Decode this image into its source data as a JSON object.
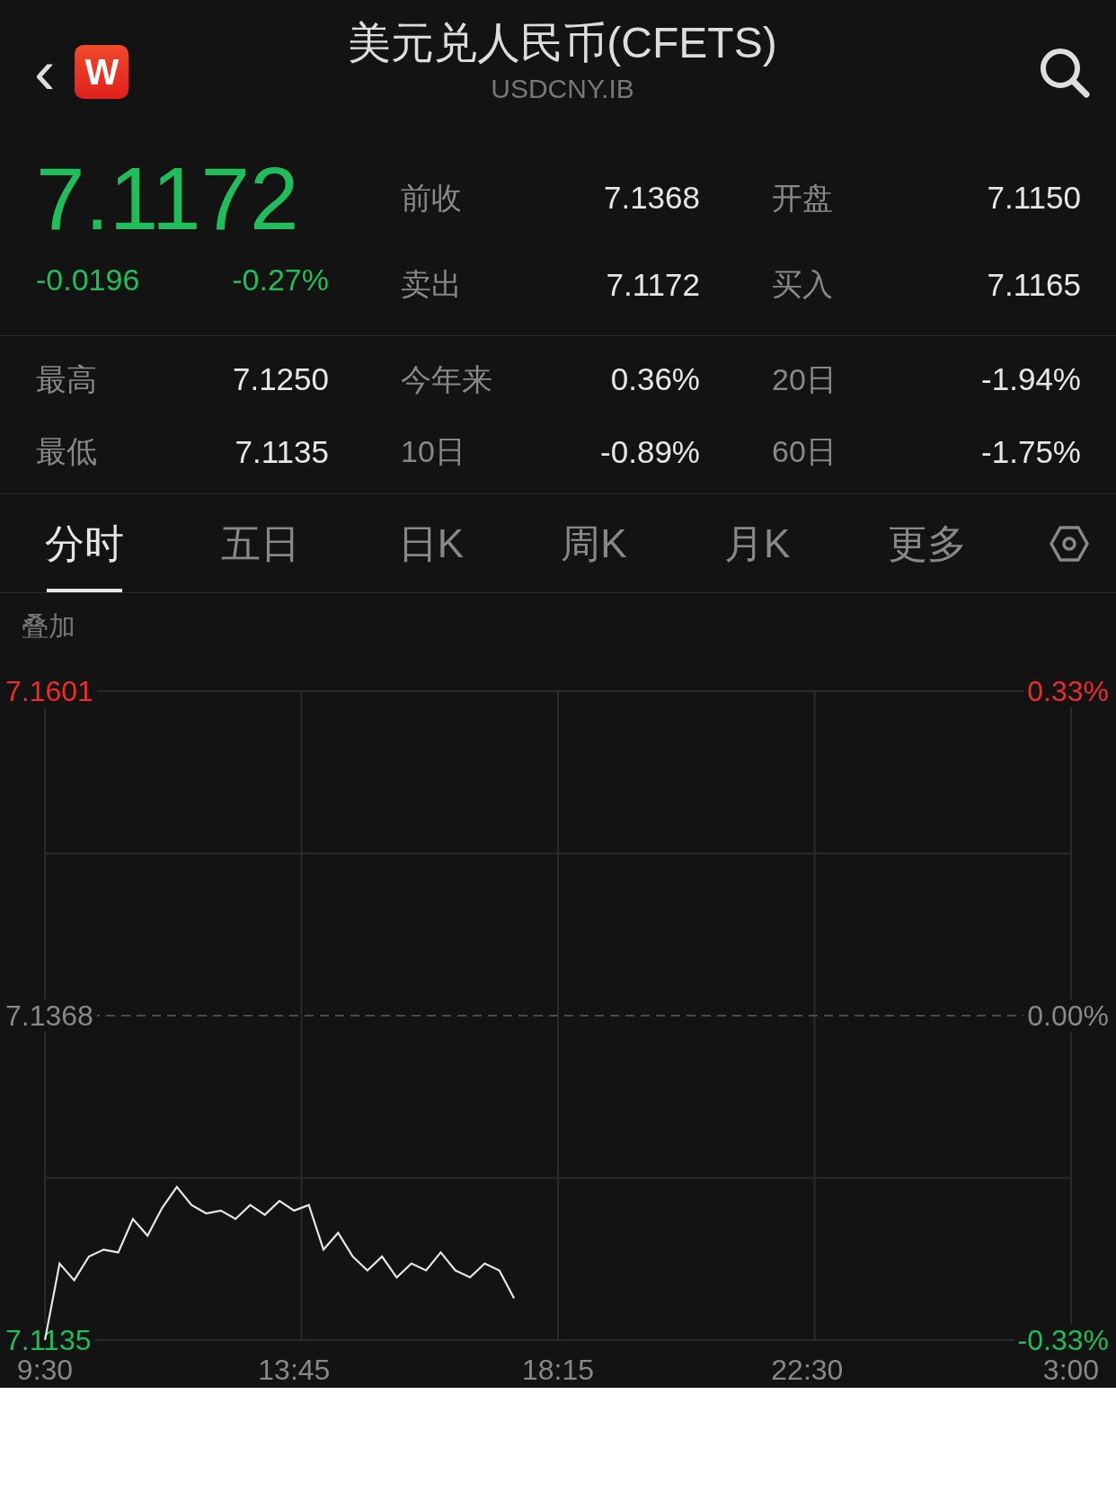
{
  "header": {
    "back": "‹",
    "app_badge": "W",
    "title": "美元兑人民币(CFETS)",
    "subtitle": "USDCNY.IB"
  },
  "quote": {
    "price": "7.1172",
    "change": "-0.0196",
    "change_pct": "-0.27%"
  },
  "stats_top": [
    {
      "label": "前收",
      "value": "7.1368"
    },
    {
      "label": "开盘",
      "value": "7.1150"
    },
    {
      "label": "卖出",
      "value": "7.1172"
    },
    {
      "label": "买入",
      "value": "7.1165"
    }
  ],
  "stats_bottom": [
    {
      "label": "最高",
      "value": "7.1250"
    },
    {
      "label": "今年来",
      "value": "0.36%"
    },
    {
      "label": "20日",
      "value": "-1.94%"
    },
    {
      "label": "最低",
      "value": "7.1135"
    },
    {
      "label": "10日",
      "value": "-0.89%"
    },
    {
      "label": "60日",
      "value": "-1.75%"
    }
  ],
  "tabs": [
    {
      "label": "分时",
      "selected": true
    },
    {
      "label": "五日",
      "selected": false
    },
    {
      "label": "日K",
      "selected": false
    },
    {
      "label": "周K",
      "selected": false
    },
    {
      "label": "月K",
      "selected": false
    },
    {
      "label": "更多",
      "selected": false
    }
  ],
  "overlay_label": "叠加",
  "right_axis_labels": [
    {
      "text": "0.33%",
      "kind": "up"
    },
    {
      "text": "0.00%",
      "kind": "flat"
    },
    {
      "text": "-0.33%",
      "kind": "down"
    }
  ],
  "chart_data": {
    "type": "line",
    "ylim": [
      7.1135,
      7.1601
    ],
    "ref_lines": [
      {
        "axis": "y",
        "value": 7.1368
      }
    ],
    "yticks": [
      {
        "value": 7.1601,
        "label": "7.1601"
      },
      {
        "value": 7.1368,
        "label": "7.1368"
      },
      {
        "value": 7.1135,
        "label": "7.1135"
      }
    ],
    "categories": [
      "9:30",
      null,
      null,
      null,
      null,
      null,
      null,
      null,
      null,
      null,
      null,
      null,
      null,
      null,
      null,
      null,
      null,
      "13:45",
      null,
      null,
      null,
      null,
      null,
      null,
      null,
      null,
      null,
      null,
      null,
      null,
      null,
      null,
      null,
      null,
      null,
      "18:15",
      null,
      null,
      null,
      null,
      null,
      null,
      null,
      null,
      null,
      null,
      null,
      null,
      null,
      null,
      null,
      null,
      "22:30",
      null,
      null,
      null,
      null,
      null,
      null,
      null,
      null,
      null,
      null,
      null,
      null,
      null,
      null,
      null,
      null,
      null,
      "3:00"
    ],
    "series": [
      {
        "color": "#e6e6e6",
        "values": [
          7.1135,
          7.119,
          7.1178,
          7.1195,
          7.12,
          7.1198,
          7.1222,
          7.121,
          7.123,
          7.1245,
          7.1232,
          7.1226,
          7.1228,
          7.1222,
          7.1232,
          7.1225,
          7.1235,
          7.1228,
          7.1232,
          7.12,
          7.1212,
          7.1195,
          7.1185,
          7.1195,
          7.118,
          7.119,
          7.1185,
          7.1198,
          7.1185,
          7.118,
          7.119,
          7.1185,
          7.1165,
          null,
          null,
          null,
          null,
          null,
          null,
          null,
          null,
          null,
          null,
          null,
          null,
          null,
          null,
          null,
          null,
          null,
          null,
          null,
          null,
          null,
          null,
          null,
          null,
          null,
          null,
          null,
          null,
          null,
          null,
          null,
          null,
          null,
          null,
          null,
          null,
          null,
          null
        ]
      }
    ]
  }
}
